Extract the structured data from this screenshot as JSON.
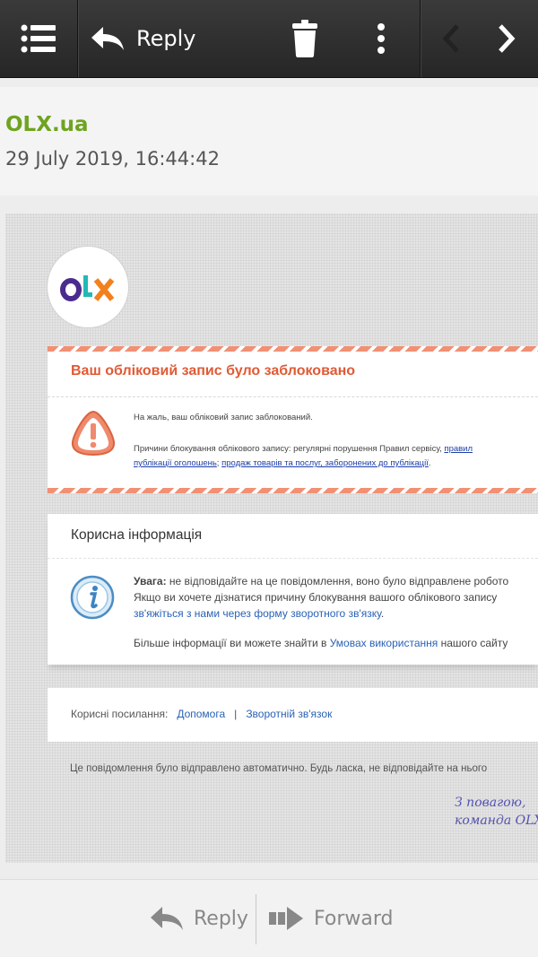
{
  "toolbar": {
    "reply_label": "Reply",
    "icons": [
      "menu-icon",
      "reply-icon",
      "trash-icon",
      "more-vertical-icon",
      "chevron-left-icon",
      "chevron-right-icon"
    ]
  },
  "email": {
    "sender": "OLX.ua",
    "date": "29 July 2019, 16:44:42"
  },
  "body": {
    "logo_text": "OLX",
    "blocked": {
      "title": "Ваш обліковий запис було заблоковано",
      "line1": "На жаль, ваш обліковий запис заблокований.",
      "line2_prefix": "Причини блокування облікового запису: регулярні порушення Правил сервісу, ",
      "line2_link": "правил",
      "line3_link1": "публікації оголошень",
      "line3_sep": "; ",
      "line3_link2": "продаж товарів та послуг, заборонених до публікації",
      "line3_end": "."
    },
    "info": {
      "title": "Корисна інформація",
      "warning_label": "Увага:",
      "warning_text": " не відповідайте на це повідомлення, воно було відправлене робото",
      "line2": "Якщо ви хочете дізнатися причину блокування вашого облікового запису",
      "line3_link": "зв'яжіться з нами через форму зворотного зв'язку",
      "line3_end": ".",
      "line4_prefix": "Більше інформації ви можете знайти в ",
      "line4_link": "Умовах використання",
      "line4_suffix": " нашого сайту"
    },
    "links": {
      "label": "Корисні посилання:",
      "help": "Допомога",
      "sep": "|",
      "feedback": "Зворотній зв'язок"
    },
    "auto_note": "Це повідомлення було відправлено автоматично. Будь ласка, не відповідайте на нього",
    "signature_line1": "З повагою,",
    "signature_line2": "команда OLX"
  },
  "bottom": {
    "reply_label": "Reply",
    "forward_label": "Forward"
  },
  "colors": {
    "sender": "#6fa320",
    "blocked_title": "#e05a35",
    "link": "#2a62b5",
    "signature": "#5452b0"
  }
}
